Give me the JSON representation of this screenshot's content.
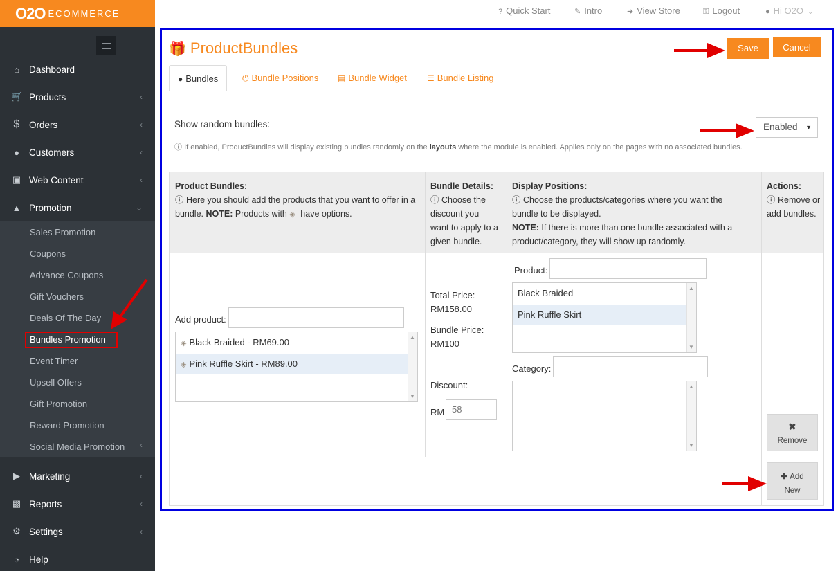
{
  "brand": {
    "logo_main": "O2O",
    "logo_sub": "ECOMMERCE"
  },
  "topbar": {
    "quick_start": "Quick Start",
    "intro": "Intro",
    "view_store": "View Store",
    "logout": "Logout",
    "user": "Hi O2O"
  },
  "sidebar": {
    "items": [
      {
        "label": "Dashboard",
        "icon": "home-icon"
      },
      {
        "label": "Products",
        "icon": "cart-icon"
      },
      {
        "label": "Orders",
        "icon": "dollar-icon"
      },
      {
        "label": "Customers",
        "icon": "user-icon"
      },
      {
        "label": "Web Content",
        "icon": "book-icon"
      },
      {
        "label": "Promotion",
        "icon": "thumbs-up-icon"
      },
      {
        "label": "Marketing",
        "icon": "bullhorn-icon"
      },
      {
        "label": "Reports",
        "icon": "bar-chart-icon"
      },
      {
        "label": "Settings",
        "icon": "gears-icon"
      },
      {
        "label": "Help",
        "icon": "help-icon"
      }
    ],
    "promotion_sub": [
      "Sales Promotion",
      "Coupons",
      "Advance Coupons",
      "Gift Vouchers",
      "Deals Of The Day",
      "Bundles Promotion",
      "Event Timer",
      "Upsell Offers",
      "Gift Promotion",
      "Reward Promotion",
      "Social Media Promotion"
    ]
  },
  "page": {
    "title": "ProductBundles",
    "save": "Save",
    "cancel": "Cancel",
    "tabs": [
      "Bundles",
      "Bundle Positions",
      "Bundle Widget",
      "Bundle Listing"
    ]
  },
  "settings": {
    "random_label": "Show random bundles:",
    "random_value": "Enabled",
    "help_pre": "If enabled, ProductBundles will display existing bundles randomly on the ",
    "help_bold": "layouts",
    "help_post": " where the module is enabled. Applies only on the pages with no associated bundles."
  },
  "table": {
    "h1_title": "Product Bundles:",
    "h1_text_a": "Here you should add the products that you want to offer in a bundle. ",
    "h1_note": "NOTE:",
    "h1_text_b": " Products with ",
    "h1_text_c": " have options.",
    "h2_title": "Bundle Details:",
    "h2_text": "Choose the discount you want to apply to a given bundle.",
    "h3_title": "Display Positions:",
    "h3_text": "Choose the products/categories where you want the bundle to be displayed.",
    "h3_note": "NOTE:",
    "h3_note_text": " If there is more than one bundle associated with a product/category, they will show up randomly.",
    "h4_title": "Actions:",
    "h4_text": "Remove or add bundles."
  },
  "bundle": {
    "add_product_label": "Add product:",
    "products": [
      "Black Braided - RM69.00",
      "Pink Ruffle Skirt - RM89.00"
    ],
    "total_price_label": "Total Price:",
    "total_price": "RM158.00",
    "bundle_price_label": "Bundle Price:",
    "bundle_price": "RM100",
    "discount_label": "Discount:",
    "currency": "RM",
    "discount_value": "58",
    "product_label": "Product:",
    "position_products": [
      "Black Braided",
      "Pink Ruffle Skirt"
    ],
    "category_label": "Category:",
    "remove": "Remove",
    "add_new_a": "Add",
    "add_new_b": "New"
  },
  "colors": {
    "accent": "#f7891f",
    "sidebar": "#2c3136",
    "frame": "#0000e0",
    "annotation": "#e10000"
  }
}
